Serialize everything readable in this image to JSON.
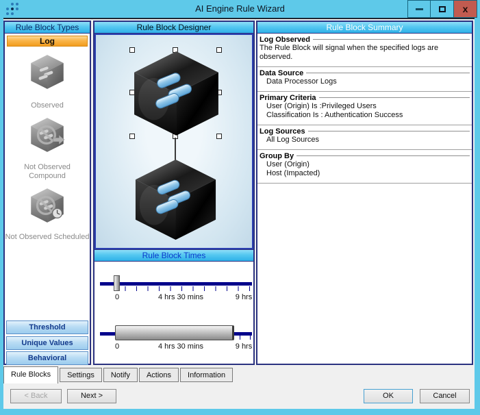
{
  "window": {
    "title": "AI Engine Rule Wizard",
    "controls": {
      "close_glyph": "x"
    }
  },
  "rule_block_types": {
    "header": "Rule Block Types",
    "selected": "Log",
    "items": [
      {
        "name": "observed",
        "label": "Observed"
      },
      {
        "name": "not-observed-compound",
        "label": "Not Observed Compound"
      },
      {
        "name": "not-observed-scheduled",
        "label": "Not Observed Scheduled"
      }
    ],
    "categories": [
      {
        "label": "Threshold"
      },
      {
        "label": "Unique Values"
      },
      {
        "label": "Behavioral"
      }
    ]
  },
  "designer": {
    "header": "Rule Block Designer"
  },
  "times": {
    "header": "Rule Block Times",
    "sliders": [
      {
        "labels": [
          "0",
          "4 hrs 30 mins",
          "9 hrs"
        ]
      },
      {
        "labels": [
          "0",
          "4 hrs 30 mins",
          "9 hrs"
        ]
      }
    ]
  },
  "summary": {
    "header": "Rule Block Summary",
    "sections": [
      {
        "title": "Log Observed",
        "lines": [
          "The Rule Block will signal when the specified logs are observed."
        ]
      },
      {
        "title": "Data Source",
        "lines": [
          "Data Processor Logs"
        ]
      },
      {
        "title": "Primary Criteria",
        "lines": [
          "User (Origin) Is :Privileged Users",
          "Classification Is : Authentication Success"
        ]
      },
      {
        "title": "Log Sources",
        "lines": [
          "All Log Sources"
        ]
      },
      {
        "title": "Group By",
        "lines": [
          "User (Origin)",
          "Host (Impacted)"
        ]
      }
    ]
  },
  "tabs": [
    {
      "label": "Rule Blocks",
      "active": true
    },
    {
      "label": "Settings",
      "active": false
    },
    {
      "label": "Notify",
      "active": false
    },
    {
      "label": "Actions",
      "active": false
    },
    {
      "label": "Information",
      "active": false
    }
  ],
  "footer": {
    "back_label": "< Back",
    "next_label": "Next >",
    "ok_label": "OK",
    "cancel_label": "Cancel"
  },
  "colors": {
    "titlebar": "#5ec9e9",
    "close_button": "#c15b50",
    "header_gradient_top": "#8fdef8",
    "header_gradient_bottom": "#2fb0e8",
    "selected_type_orange": "#f9b54a",
    "panel_border": "#2b3280",
    "slider_track": "#00008b"
  }
}
